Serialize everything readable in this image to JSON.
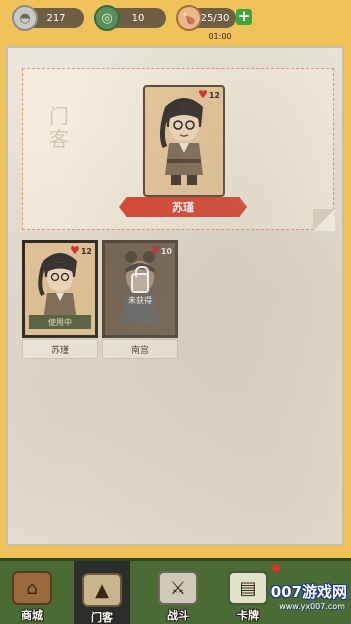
{
  "resources": {
    "silver": "217",
    "jade": "10",
    "stamina": "25/30",
    "timer": "01:00"
  },
  "showcase": {
    "title": "门客",
    "hero": {
      "name": "苏瑾",
      "affinity": "12"
    }
  },
  "roster": [
    {
      "name": "苏瑾",
      "affinity": "12",
      "status": "使用中"
    },
    {
      "name": "南宫",
      "affinity": "10",
      "status": "未获得"
    }
  ],
  "nav": [
    {
      "label": "商城",
      "icon": "shop-icon"
    },
    {
      "label": "门客",
      "icon": "retainer-icon"
    },
    {
      "label": "战斗",
      "icon": "battle-icon"
    },
    {
      "label": "卡牌",
      "icon": "card-icon"
    }
  ],
  "watermark": {
    "brand": "007游戏网",
    "url": "www.yx007.com"
  },
  "colors": {
    "accent": "#d8402e",
    "nav_bg": "#4b6b35",
    "page_bg": "#f0c35a"
  }
}
